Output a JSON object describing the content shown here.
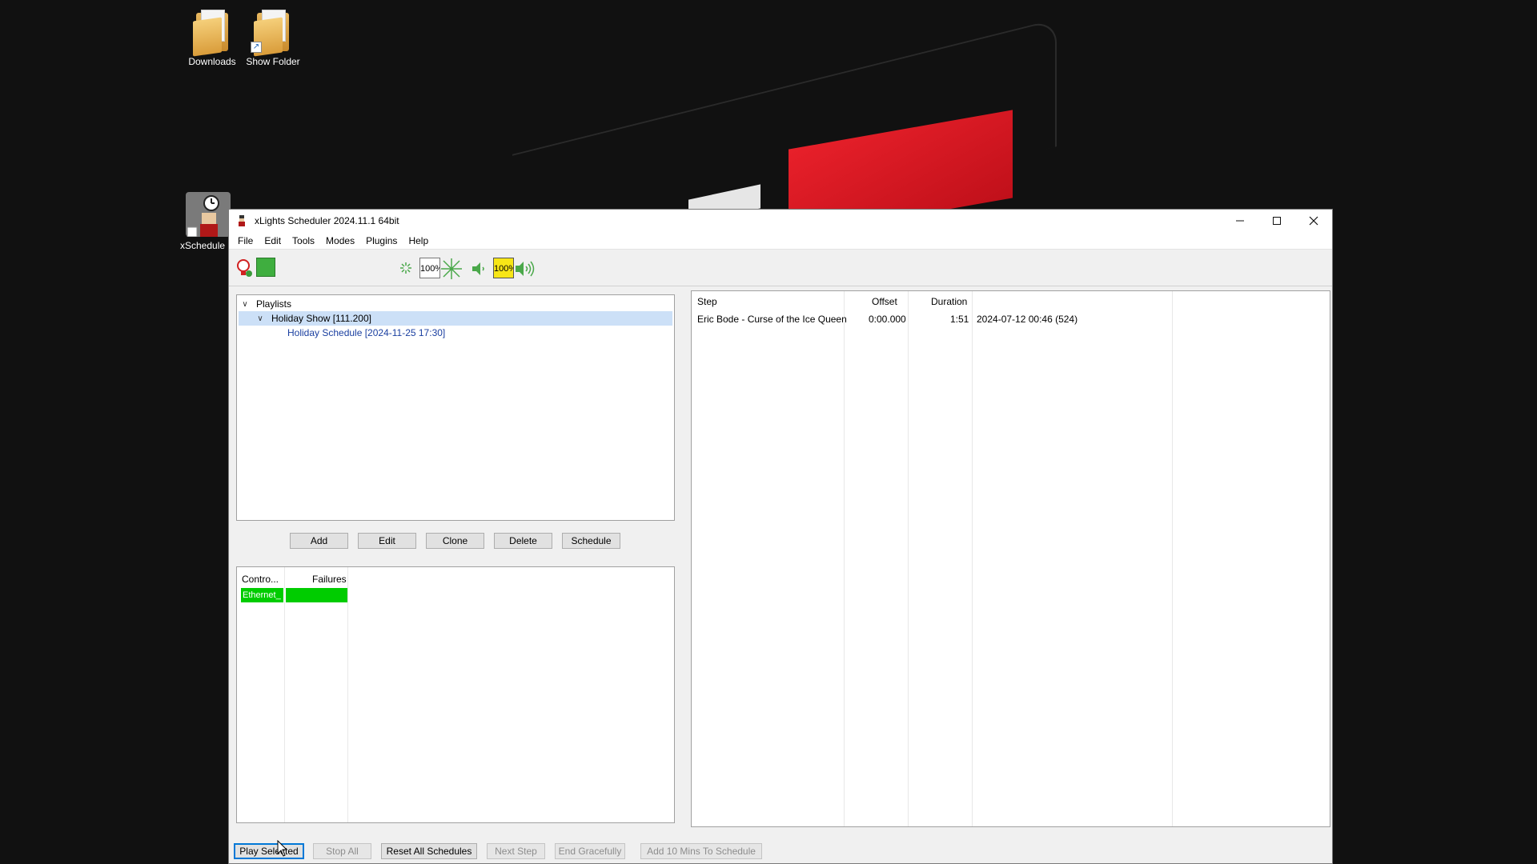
{
  "desktop": {
    "icons": [
      {
        "label": "Downloads"
      },
      {
        "label": "Show Folder"
      },
      {
        "label": "xSchedule"
      }
    ]
  },
  "window": {
    "title": "xLights Scheduler 2024.11.1 64bit",
    "menu": [
      "File",
      "Edit",
      "Tools",
      "Modes",
      "Plugins",
      "Help"
    ],
    "toolbar": {
      "brightness_value": "100%",
      "volume_value": "100%"
    },
    "playlists": {
      "root_label": "Playlists",
      "playlist_label": "Holiday Show [111.200]",
      "schedule_label": "Holiday Schedule [2024-11-25 17:30]"
    },
    "playlist_buttons": {
      "add": "Add",
      "edit": "Edit",
      "clone": "Clone",
      "delete": "Delete",
      "schedule": "Schedule"
    },
    "controllers": {
      "headers": [
        "Contro...",
        "Failures"
      ],
      "rows": [
        {
          "name": "Ethernet_",
          "failures": "",
          "status_color": "#00cc00"
        }
      ]
    },
    "steps": {
      "headers": [
        "Step",
        "Offset",
        "Duration"
      ],
      "rows": [
        {
          "step": "Eric Bode - Curse of the Ice Queen",
          "offset": "0:00.000",
          "duration": "1:51",
          "date": "2024-07-12 00:46 (524)"
        }
      ]
    },
    "bottom_buttons": {
      "play_selected": "Play Selected",
      "stop_all": "Stop All",
      "reset_all_schedules": "Reset All Schedules",
      "next_step": "Next Step",
      "end_gracefully": "End Gracefully",
      "add_10_mins": "Add 10 Mins To Schedule"
    }
  }
}
